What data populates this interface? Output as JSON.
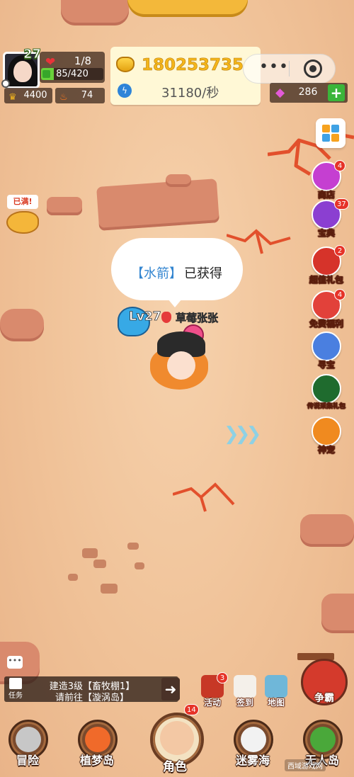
{
  "player": {
    "level": "27",
    "lives": "1/8",
    "hp": "85/420",
    "hp_fraction": 0.2,
    "crown_value": "4400",
    "fire_value": "74"
  },
  "currency": {
    "gold": "180253735",
    "speed": "31180/秒",
    "gems": "286"
  },
  "right_menu": [
    {
      "label": "商店",
      "badge": "4",
      "color": "#c53fd1"
    },
    {
      "label": "宝典",
      "badge": "37",
      "color": "#8b3fd1"
    },
    {
      "label": "超值礼包",
      "badge": "2",
      "color": "#d6332a"
    },
    {
      "label": "免费福利",
      "badge": "4",
      "color": "#e2413a"
    },
    {
      "label": "寻宝",
      "badge": "",
      "color": "#4a7fe0"
    },
    {
      "label": "传说采集礼包",
      "badge": "",
      "color": "#1f6b2e"
    },
    {
      "label": "神宠",
      "badge": "",
      "color": "#f08a1f"
    }
  ],
  "piggy": {
    "tag": "已满!"
  },
  "bubble": {
    "item": "【水箭】",
    "text": "已获得"
  },
  "character": {
    "level": "Lv27",
    "name": "草莓张张"
  },
  "quest": {
    "icon_label": "任务",
    "line1": "建造3级【畜牧棚1】",
    "line2": "请前往【漩涡岛】"
  },
  "mini_buttons": [
    {
      "label": "活动",
      "badge": "3",
      "color": "#c73826"
    },
    {
      "label": "签到",
      "badge": "",
      "color": "#f4f0ea"
    },
    {
      "label": "地图",
      "badge": "",
      "color": "#6fb7d9"
    }
  ],
  "battle": {
    "label": "争霸"
  },
  "bottom_nav": [
    {
      "label": "冒险",
      "color": "#c7c7c7"
    },
    {
      "label": "植梦岛",
      "color": "#f06a2a"
    },
    {
      "label": "角色",
      "badge": "14",
      "color": "#f3c8a4"
    },
    {
      "label": "迷雾海",
      "color": "#f2f2f2"
    },
    {
      "label": "无人岛",
      "color": "#4aa83a"
    }
  ],
  "watermark": "西域游戏网"
}
